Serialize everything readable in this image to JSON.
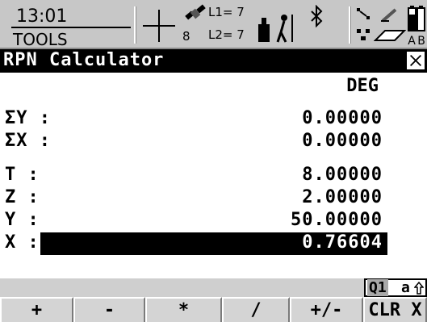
{
  "status": {
    "time": "13:01",
    "mode": "TOOLS",
    "gnss": {
      "satellites": "8",
      "l1_label": "L1= 7",
      "l2_label": "L2= 7"
    },
    "battery_labels": [
      "A",
      "B"
    ],
    "icons": [
      "crosshair-icon",
      "satellite-icon",
      "rover-icon",
      "bluetooth-icon",
      "radio-icon",
      "network-icon",
      "pen-icon",
      "memory-card-icon",
      "battery-icon"
    ]
  },
  "window": {
    "title": "RPN Calculator"
  },
  "calculator": {
    "angle_mode": "DEG",
    "sums": [
      {
        "label": "ΣY :",
        "value": "0.00000"
      },
      {
        "label": "ΣX :",
        "value": "0.00000"
      }
    ],
    "stack": [
      {
        "label": "T  :",
        "value": "8.00000"
      },
      {
        "label": "Z  :",
        "value": "2.00000"
      },
      {
        "label": "Y  :",
        "value": "50.00000"
      },
      {
        "label": "X  :",
        "value": "0.76604"
      }
    ]
  },
  "keyboard": {
    "mode": "Q1",
    "case": "a"
  },
  "fkeys": [
    "+",
    "-",
    "*",
    "/",
    "+/-",
    "CLR X"
  ]
}
